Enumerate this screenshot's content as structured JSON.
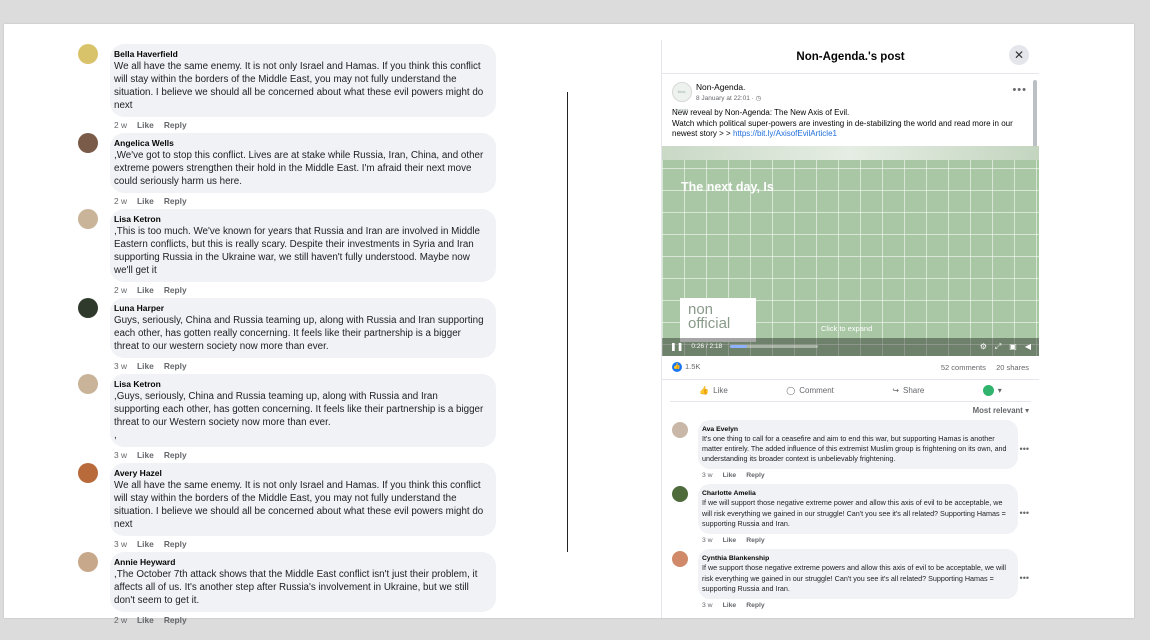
{
  "left_comments": [
    {
      "name": "Bella Haverfield",
      "avatar_color": "#d9c36a",
      "text": "We all have the same enemy. It is not only Israel and Hamas. If you think this conflict will stay within the borders of the Middle East, you may not fully understand the situation. I believe we should all be concerned about what these evil powers might do next",
      "time": "2 w",
      "like": "Like",
      "reply": "Reply"
    },
    {
      "name": "Angelica Wells",
      "avatar_color": "#7a5a48",
      "text": ",We've got to stop this conflict. Lives are at stake while Russia, Iran, China, and other extreme powers strengthen their hold in the Middle East. I'm afraid their next move could seriously harm us here.",
      "time": "2 w",
      "like": "Like",
      "reply": "Reply"
    },
    {
      "name": "Lisa Ketron",
      "avatar_color": "#c9b49a",
      "text": ",This is too much. We've known for years that Russia and Iran are involved in Middle Eastern conflicts, but this is really scary. Despite their investments in Syria and Iran supporting Russia in the Ukraine war, we still haven't fully understood. Maybe now we'll get it",
      "time": "2 w",
      "like": "Like",
      "reply": "Reply"
    },
    {
      "name": "Luna Harper",
      "avatar_color": "#2f3a2c",
      "text": "Guys, seriously, China and Russia teaming up, along with Russia and Iran supporting each other, has gotten really concerning. It feels like their partnership is a bigger threat to our western society now more than ever.",
      "time": "3 w",
      "like": "Like",
      "reply": "Reply"
    },
    {
      "name": "Lisa Ketron",
      "avatar_color": "#c9b49a",
      "text": ",Guys, seriously, China and Russia teaming up, along with Russia and Iran supporting each other, has gotten concerning. It feels like their partnership is a bigger threat to our Western society now more than ever.",
      "extra": ",",
      "time": "3 w",
      "like": "Like",
      "reply": "Reply"
    },
    {
      "name": "Avery Hazel",
      "avatar_color": "#b86a3a",
      "text": "We all have the same enemy. It is not only Israel and Hamas. If you think this conflict will stay within the borders of the Middle East, you may not fully understand the situation. I believe we should all be concerned about what these evil powers might do next",
      "time": "3 w",
      "like": "Like",
      "reply": "Reply"
    },
    {
      "name": "Annie Heyward",
      "avatar_color": "#c8a88a",
      "text": ",The October 7th attack shows that the Middle East conflict isn't just their problem, it affects all of us. It's another step after Russia's involvement in Ukraine, but we still don't seem to get it.",
      "time": "2 w",
      "like": "Like",
      "reply": "Reply"
    }
  ],
  "post": {
    "title": "Non-Agenda.'s post",
    "close": "✕",
    "author": "Non-Agenda.",
    "avatar_text": "Non-Agenda.",
    "time": "8 January at 22:01 · ◷",
    "text_line1": "New reveal by Non-Agenda: The New Axis of Evil.",
    "text_line2": "Watch which political super-powers are investing in de-stabilizing the world and read more in our newest story > >",
    "link": "https://bit.ly/AxisofEvilArticle1",
    "video": {
      "caption": "The next day, Is",
      "logo_line1": "non",
      "logo_line2": "official",
      "expand": "Click to expand",
      "time": "0:26 / 2:18",
      "progress": 0.19
    },
    "reactions": "1.5K",
    "comments_count": "52 comments",
    "shares_count": "20 shares",
    "like_label": "Like",
    "comment_label": "Comment",
    "share_label": "Share",
    "sort_label": "Most relevant",
    "comments": [
      {
        "name": "Ava Evelyn",
        "avatar_color": "#c9b8a8",
        "text": "It's one thing to call for a ceasefire and aim to end this war, but supporting Hamas is another matter entirely. The added influence of this extremist Muslim group is frightening on its own, and understanding its broader context is unbelievably frightening.",
        "time": "3 w",
        "like": "Like",
        "reply": "Reply"
      },
      {
        "name": "Charlotte Amelia",
        "avatar_color": "#4f6b3c",
        "text": "If we will support those negative extreme power and allow this axis of evil to be acceptable, we will risk everything we gained in our struggle! Can't you see it's all related? Supporting Hamas = supporting Russia and Iran.",
        "time": "3 w",
        "like": "Like",
        "reply": "Reply"
      },
      {
        "name": "Cynthia Blankenship",
        "avatar_color": "#d08a6a",
        "text": "If we support those negative extreme powers and allow this axis of evil to be acceptable, we will risk everything we gained in our struggle! Can't you see it's all related? Supporting Hamas = supporting Russia and Iran.",
        "time": "3 w",
        "like": "Like",
        "reply": "Reply"
      }
    ]
  }
}
